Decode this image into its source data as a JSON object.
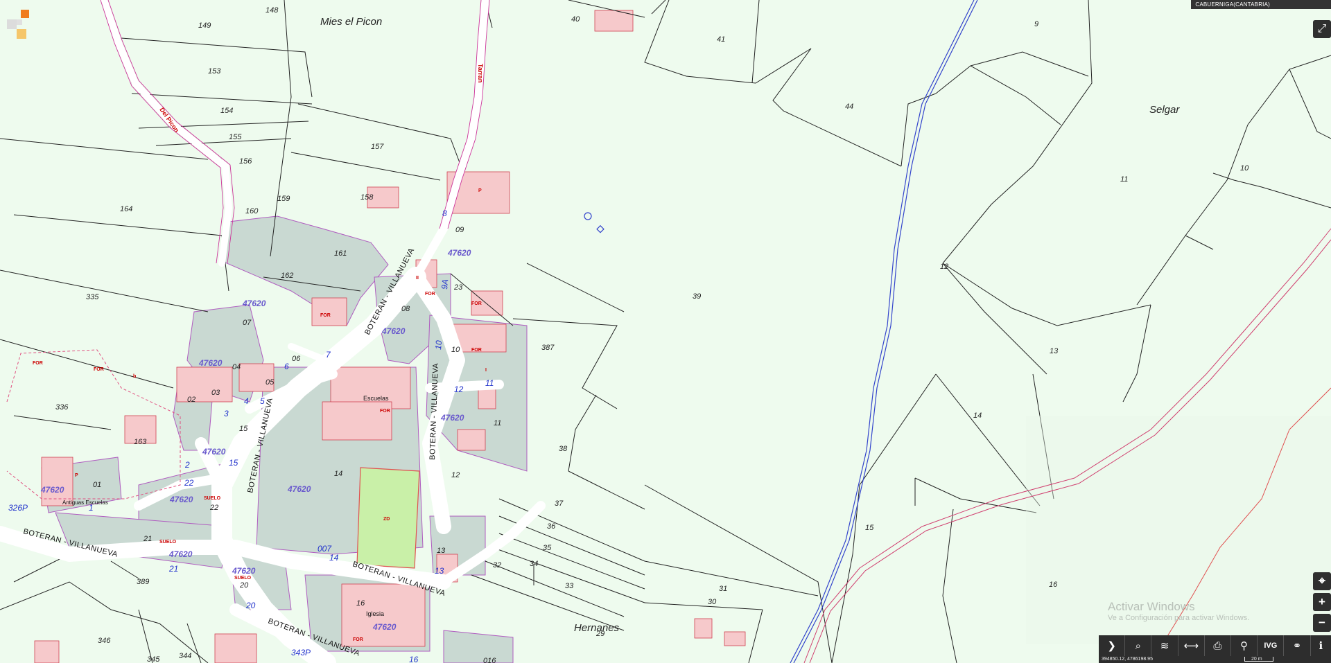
{
  "region_label": "CABUERNIGA(CANTABRIA)",
  "place_names": [
    "Mies el Picon",
    "Selgar",
    "Hernanes"
  ],
  "parcel_numbers": [
    "148",
    "149",
    "153",
    "154",
    "155",
    "156",
    "157",
    "158",
    "159",
    "160",
    "161",
    "162",
    "164",
    "335",
    "336",
    "163",
    "389",
    "346",
    "345",
    "344",
    "40",
    "41",
    "9",
    "44",
    "11",
    "10",
    "12",
    "13",
    "14",
    "15",
    "16",
    "39",
    "387",
    "38",
    "37",
    "36",
    "35",
    "34",
    "33",
    "32",
    "31",
    "30",
    "29",
    "07",
    "08",
    "09",
    "23",
    "10",
    "11",
    "12",
    "13",
    "16",
    "20",
    "21",
    "22",
    "01",
    "02",
    "03",
    "04",
    "05",
    "06",
    "14",
    "15",
    "016"
  ],
  "block_numbers": [
    "47620"
  ],
  "streets": [
    "BOTERAN - VILLANUEVA",
    "BOTERAN - VILLANUEVA",
    "BOTERAN - VILLANUEVA",
    "BOTERAN - VILLANUEVA",
    "BOTERAN - VILLANUEVA",
    "BOTERAN - VILLANUEVA"
  ],
  "minor_streets": [
    "Del Picon",
    "Tarran"
  ],
  "house_numbers": [
    "9A",
    "8",
    "7",
    "6",
    "5",
    "4",
    "3",
    "2",
    "1",
    "10",
    "11",
    "12",
    "14",
    "15",
    "16",
    "20",
    "21",
    "22",
    "13",
    "007",
    "326P",
    "343P"
  ],
  "buildings": [
    "Escuelas",
    "Iglesia",
    "Antiguas Escuelas",
    "ZD",
    "SUELO",
    "FOR",
    "I",
    "II",
    "P",
    "b"
  ],
  "fullscreen_icon": "expand-icon",
  "side_tools": [
    {
      "icon": "target-icon",
      "glyph": "⌖"
    },
    {
      "icon": "zoom-in-icon",
      "glyph": "+"
    },
    {
      "icon": "zoom-out-icon",
      "glyph": "−"
    }
  ],
  "toolbar": [
    {
      "icon": "chevron-right-icon",
      "glyph": "❯"
    },
    {
      "icon": "search-icon",
      "glyph": "⌕"
    },
    {
      "icon": "layers-icon",
      "glyph": "≋"
    },
    {
      "icon": "measure-icon",
      "glyph": "⟷"
    },
    {
      "icon": "print-icon",
      "glyph": "⎙"
    },
    {
      "icon": "pin-icon",
      "glyph": "⚲"
    },
    {
      "icon": "ivg-label",
      "glyph": "IVG"
    },
    {
      "icon": "share-icon",
      "glyph": "⚭"
    },
    {
      "icon": "info-icon",
      "glyph": "ℹ"
    }
  ],
  "status": {
    "coordinates": "394850.12, 4786198.95",
    "scale": "20 m"
  },
  "watermark": {
    "title": "Activar Windows",
    "subtitle": "Ve a Configuración para activar Windows."
  }
}
